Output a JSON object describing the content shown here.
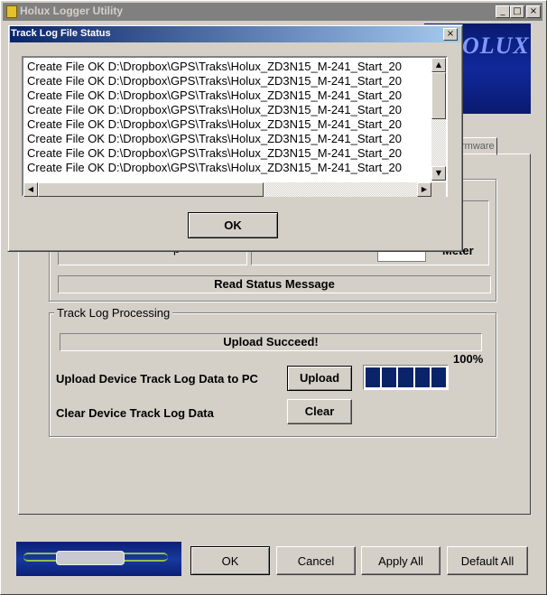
{
  "window": {
    "title": "Holux Logger Utility",
    "banner_text": "OLUX",
    "tab_firmware": "rmware"
  },
  "status_group": {
    "read_status": "Read Status Message",
    "partial_left": "p",
    "partial_right": "Meter"
  },
  "track_log": {
    "group_label": "Track Log Processing",
    "status": "Upload Succeed!",
    "percent": "100%",
    "progress_fraction": 1.0,
    "upload_label": "Upload Device Track Log Data to PC",
    "upload_button": "Upload",
    "clear_label": "Clear Device Track Log Data",
    "clear_button": "Clear"
  },
  "footer": {
    "ok": "OK",
    "cancel": "Cancel",
    "apply_all": "Apply All",
    "default_all": "Default All"
  },
  "dialog": {
    "title": "Track Log File Status",
    "lines": [
      "Create File OK D:\\Dropbox\\GPS\\Traks\\Holux_ZD3N15_M-241_Start_20",
      "Create File OK D:\\Dropbox\\GPS\\Traks\\Holux_ZD3N15_M-241_Start_20",
      "Create File OK D:\\Dropbox\\GPS\\Traks\\Holux_ZD3N15_M-241_Start_20",
      "Create File OK D:\\Dropbox\\GPS\\Traks\\Holux_ZD3N15_M-241_Start_20",
      "Create File OK D:\\Dropbox\\GPS\\Traks\\Holux_ZD3N15_M-241_Start_20",
      "Create File OK D:\\Dropbox\\GPS\\Traks\\Holux_ZD3N15_M-241_Start_20",
      "Create File OK D:\\Dropbox\\GPS\\Traks\\Holux_ZD3N15_M-241_Start_20",
      "Create File OK D:\\Dropbox\\GPS\\Traks\\Holux_ZD3N15_M-241_Start_20"
    ],
    "ok_button": "OK"
  },
  "icons": {
    "minimize": "minimize-icon",
    "maximize": "maximize-icon",
    "close": "close-icon",
    "scroll_up": "arrow-up-icon",
    "scroll_down": "arrow-down-icon",
    "scroll_left": "arrow-left-icon",
    "scroll_right": "arrow-right-icon"
  }
}
